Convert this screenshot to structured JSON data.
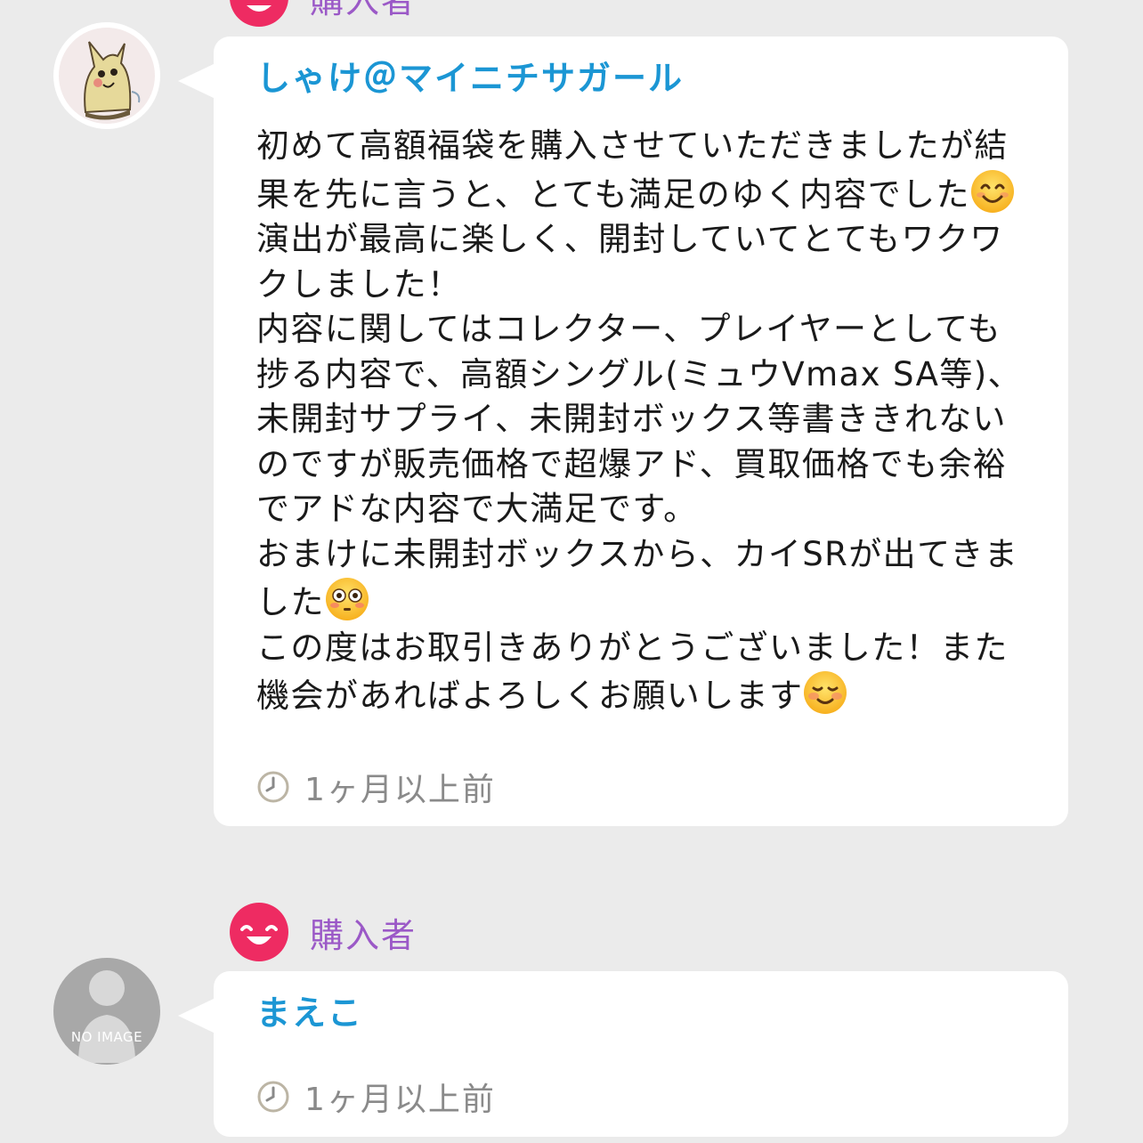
{
  "reviews": [
    {
      "rating_label": "購入者",
      "username": "しゃけ＠マイニチサガール",
      "comment_parts": [
        "初めて高額福袋を購入させていただきましたが結果を先に言うと、とても満足のゆく内容でした",
        "\n演出が最高に楽しく、開封していてとてもワクワクしました！\n内容に関してはコレクター、プレイヤーとしても捗る内容で、高額シングル(ミュウVmax SA等)、未開封サプライ、未開封ボックス等書ききれないのですが販売価格で超爆アド、買取価格でも余裕でアドな内容で大満足です。\nおまけに未開封ボックスから、カイSRが出てきました",
        "\nこの度はお取引きありがとうございました！また機会があればよろしくお願いします"
      ],
      "emojis": [
        "smiling-face-with-smiling-eyes",
        "flushed-face",
        "smiling-face"
      ],
      "time": "1ヶ月以上前"
    },
    {
      "rating_label": "購入者",
      "username": "まえこ",
      "avatar_text": "NO IMAGE",
      "time": "1ヶ月以上前"
    }
  ],
  "colors": {
    "background": "#ebebeb",
    "smile_badge": "#ee2b62",
    "rating_label": "#9b59c7",
    "username": "#1b96d4",
    "time": "#8a8a8a"
  }
}
